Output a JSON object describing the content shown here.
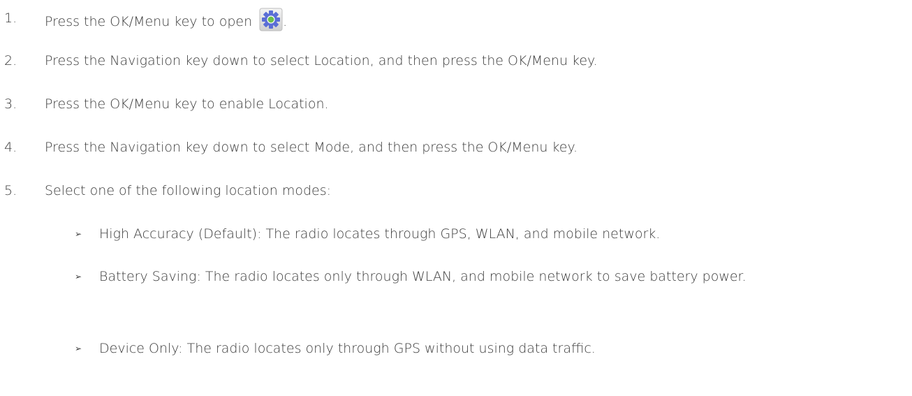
{
  "steps": [
    {
      "num": "1.",
      "text": "Press the OK/Menu key to open ",
      "suffix": "."
    },
    {
      "num": "2.",
      "text": "Press the Navigation key down to select Location, and then press the OK/Menu key."
    },
    {
      "num": "3.",
      "text": "Press the OK/Menu key to enable Location."
    },
    {
      "num": "4.",
      "text": "Press the Navigation key down to select Mode, and then press the OK/Menu key."
    },
    {
      "num": "5.",
      "text": "Select one of the following location modes:"
    }
  ],
  "bullets": [
    {
      "marker": "➢",
      "text": "High Accuracy (Default): The radio locates through GPS, WLAN, and mobile network."
    },
    {
      "marker": "➢",
      "text": "Battery Saving: The radio locates only through WLAN, and mobile network to save battery power."
    },
    {
      "marker": "➢",
      "text": "Device Only: The radio locates only through GPS without using data traffic."
    }
  ],
  "icons": {
    "settings": "settings-gear-icon",
    "gear_color": "#5b6ed6",
    "center_color": "#6cc04a"
  }
}
